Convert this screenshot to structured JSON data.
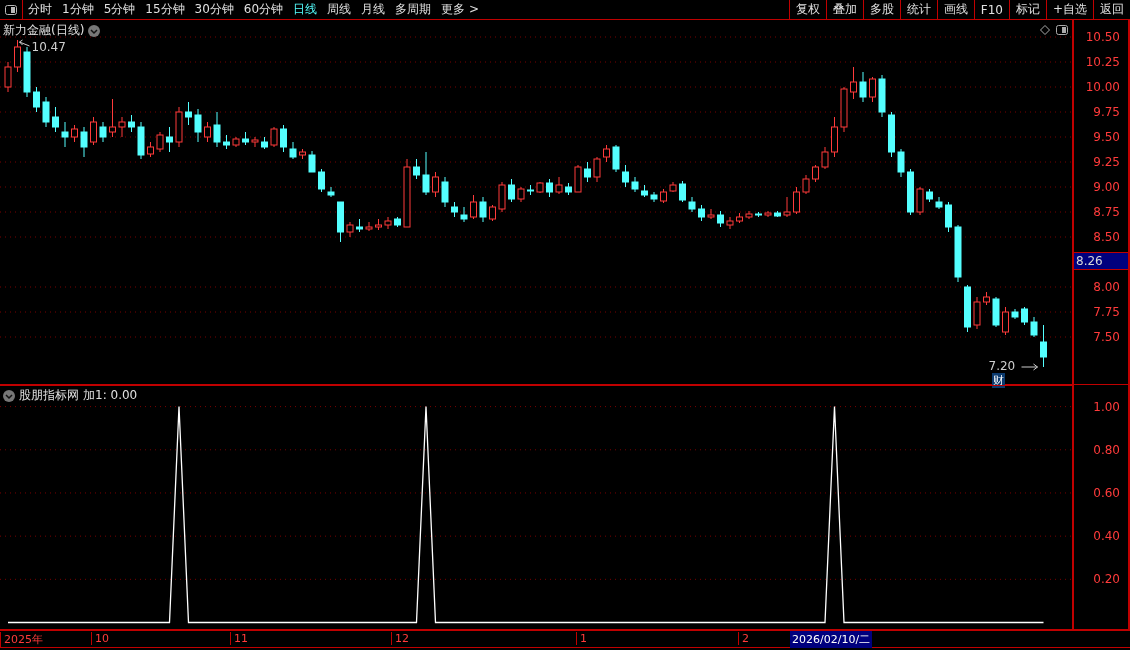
{
  "toolbar": {
    "periods": [
      {
        "label": "分时",
        "selected": false
      },
      {
        "label": "1分钟",
        "selected": false
      },
      {
        "label": "5分钟",
        "selected": false
      },
      {
        "label": "15分钟",
        "selected": false
      },
      {
        "label": "30分钟",
        "selected": false
      },
      {
        "label": "60分钟",
        "selected": false
      },
      {
        "label": "日线",
        "selected": true
      },
      {
        "label": "周线",
        "selected": false
      },
      {
        "label": "月线",
        "selected": false
      },
      {
        "label": "多周期",
        "selected": false
      },
      {
        "label": "更多 >",
        "selected": false
      }
    ],
    "actions": [
      "复权",
      "叠加",
      "多股",
      "统计",
      "画线",
      "F10",
      "标记",
      "+自选",
      "返回"
    ]
  },
  "main_chart": {
    "title": "新力金融(日线)",
    "high_marker": "10.47",
    "low_marker": "7.20",
    "finance_badge": "财",
    "current_price": "8.26",
    "chart_data": {
      "type": "candlestick",
      "ylim": [
        7.03,
        10.67
      ],
      "grid": true,
      "yticks": [
        {
          "value": 10.5,
          "label": "10.50"
        },
        {
          "value": 10.25,
          "label": "10.25"
        },
        {
          "value": 10,
          "label": "10.00"
        },
        {
          "value": 9.75,
          "label": "9.75"
        },
        {
          "value": 9.5,
          "label": "9.50"
        },
        {
          "value": 9.25,
          "label": "9.25"
        },
        {
          "value": 9,
          "label": "9.00"
        },
        {
          "value": 8.75,
          "label": "8.75"
        },
        {
          "value": 8.5,
          "label": "8.50"
        },
        {
          "value": 8,
          "label": "8.00"
        },
        {
          "value": 7.75,
          "label": "7.75"
        },
        {
          "value": 7.5,
          "label": "7.50"
        }
      ],
      "ohlc": [
        [
          10.0,
          10.25,
          9.95,
          10.2
        ],
        [
          10.2,
          10.47,
          10.15,
          10.4
        ],
        [
          10.35,
          10.4,
          9.9,
          9.95
        ],
        [
          9.95,
          10.0,
          9.75,
          9.8
        ],
        [
          9.85,
          9.9,
          9.6,
          9.65
        ],
        [
          9.7,
          9.8,
          9.55,
          9.6
        ],
        [
          9.55,
          9.65,
          9.4,
          9.5
        ],
        [
          9.5,
          9.62,
          9.45,
          9.58
        ],
        [
          9.55,
          9.6,
          9.3,
          9.4
        ],
        [
          9.45,
          9.7,
          9.42,
          9.65
        ],
        [
          9.6,
          9.65,
          9.45,
          9.5
        ],
        [
          9.55,
          9.88,
          9.5,
          9.6
        ],
        [
          9.6,
          9.7,
          9.5,
          9.65
        ],
        [
          9.65,
          9.72,
          9.55,
          9.6
        ],
        [
          9.6,
          9.65,
          9.28,
          9.32
        ],
        [
          9.33,
          9.45,
          9.3,
          9.4
        ],
        [
          9.38,
          9.55,
          9.35,
          9.52
        ],
        [
          9.5,
          9.6,
          9.35,
          9.45
        ],
        [
          9.45,
          9.8,
          9.4,
          9.75
        ],
        [
          9.75,
          9.85,
          9.62,
          9.7
        ],
        [
          9.72,
          9.78,
          9.45,
          9.55
        ],
        [
          9.5,
          9.65,
          9.45,
          9.6
        ],
        [
          9.62,
          9.75,
          9.4,
          9.45
        ],
        [
          9.45,
          9.52,
          9.38,
          9.42
        ],
        [
          9.42,
          9.5,
          9.4,
          9.48
        ],
        [
          9.48,
          9.55,
          9.42,
          9.45
        ],
        [
          9.45,
          9.5,
          9.4,
          9.47
        ],
        [
          9.45,
          9.5,
          9.38,
          9.4
        ],
        [
          9.42,
          9.6,
          9.4,
          9.58
        ],
        [
          9.58,
          9.62,
          9.35,
          9.4
        ],
        [
          9.38,
          9.45,
          9.28,
          9.3
        ],
        [
          9.32,
          9.38,
          9.28,
          9.35
        ],
        [
          9.32,
          9.36,
          9.15,
          9.15
        ],
        [
          9.15,
          9.18,
          8.95,
          8.98
        ],
        [
          8.95,
          9.0,
          8.9,
          8.92
        ],
        [
          8.85,
          8.85,
          8.45,
          8.55
        ],
        [
          8.55,
          8.65,
          8.5,
          8.62
        ],
        [
          8.6,
          8.68,
          8.55,
          8.58
        ],
        [
          8.58,
          8.65,
          8.56,
          8.6
        ],
        [
          8.6,
          8.68,
          8.57,
          8.62
        ],
        [
          8.62,
          8.7,
          8.58,
          8.66
        ],
        [
          8.68,
          8.7,
          8.6,
          8.62
        ],
        [
          8.6,
          9.28,
          8.6,
          9.2
        ],
        [
          9.2,
          9.28,
          9.08,
          9.12
        ],
        [
          9.12,
          9.35,
          8.92,
          8.95
        ],
        [
          8.95,
          9.15,
          8.9,
          9.1
        ],
        [
          9.05,
          9.1,
          8.8,
          8.85
        ],
        [
          8.8,
          8.85,
          8.7,
          8.75
        ],
        [
          8.72,
          8.8,
          8.65,
          8.68
        ],
        [
          8.7,
          8.92,
          8.68,
          8.85
        ],
        [
          8.85,
          8.9,
          8.65,
          8.7
        ],
        [
          8.68,
          8.82,
          8.66,
          8.8
        ],
        [
          8.78,
          9.05,
          8.75,
          9.02
        ],
        [
          9.02,
          9.08,
          8.85,
          8.88
        ],
        [
          8.88,
          9.0,
          8.85,
          8.98
        ],
        [
          8.97,
          9.02,
          8.92,
          8.96
        ],
        [
          8.95,
          9.05,
          8.94,
          9.04
        ],
        [
          9.04,
          9.08,
          8.9,
          8.95
        ],
        [
          8.95,
          9.1,
          8.93,
          9.02
        ],
        [
          9.0,
          9.04,
          8.92,
          8.95
        ],
        [
          8.95,
          9.22,
          8.95,
          9.2
        ],
        [
          9.18,
          9.25,
          9.05,
          9.1
        ],
        [
          9.1,
          9.3,
          9.05,
          9.28
        ],
        [
          9.3,
          9.42,
          9.25,
          9.38
        ],
        [
          9.4,
          9.42,
          9.15,
          9.18
        ],
        [
          9.15,
          9.22,
          9.0,
          9.05
        ],
        [
          9.05,
          9.1,
          8.95,
          8.98
        ],
        [
          8.96,
          9.02,
          8.9,
          8.92
        ],
        [
          8.92,
          8.95,
          8.85,
          8.88
        ],
        [
          8.86,
          8.98,
          8.84,
          8.95
        ],
        [
          8.96,
          9.05,
          8.95,
          9.02
        ],
        [
          9.03,
          9.06,
          8.85,
          8.87
        ],
        [
          8.85,
          8.9,
          8.75,
          8.78
        ],
        [
          8.78,
          8.82,
          8.66,
          8.7
        ],
        [
          8.7,
          8.78,
          8.68,
          8.72
        ],
        [
          8.72,
          8.76,
          8.6,
          8.64
        ],
        [
          8.62,
          8.7,
          8.58,
          8.66
        ],
        [
          8.66,
          8.74,
          8.64,
          8.7
        ],
        [
          8.7,
          8.76,
          8.68,
          8.73
        ],
        [
          8.73,
          8.75,
          8.7,
          8.72
        ],
        [
          8.72,
          8.76,
          8.7,
          8.74
        ],
        [
          8.74,
          8.76,
          8.7,
          8.71
        ],
        [
          8.72,
          8.9,
          8.7,
          8.75
        ],
        [
          8.75,
          9.0,
          8.73,
          8.95
        ],
        [
          8.95,
          9.12,
          8.93,
          9.08
        ],
        [
          9.08,
          9.22,
          9.05,
          9.2
        ],
        [
          9.2,
          9.4,
          9.18,
          9.35
        ],
        [
          9.35,
          9.7,
          9.3,
          9.6
        ],
        [
          9.6,
          10.0,
          9.55,
          9.98
        ],
        [
          9.95,
          10.2,
          9.88,
          10.05
        ],
        [
          10.05,
          10.15,
          9.85,
          9.9
        ],
        [
          9.9,
          10.1,
          9.85,
          10.08
        ],
        [
          10.08,
          10.12,
          9.7,
          9.75
        ],
        [
          9.72,
          9.75,
          9.3,
          9.35
        ],
        [
          9.35,
          9.38,
          9.1,
          9.15
        ],
        [
          9.15,
          9.18,
          8.72,
          8.75
        ],
        [
          8.75,
          9.0,
          8.72,
          8.98
        ],
        [
          8.95,
          8.98,
          8.85,
          8.88
        ],
        [
          8.85,
          8.9,
          8.78,
          8.8
        ],
        [
          8.82,
          8.85,
          8.55,
          8.6
        ],
        [
          8.6,
          8.62,
          8.05,
          8.1
        ],
        [
          8.0,
          8.02,
          7.55,
          7.6
        ],
        [
          7.62,
          7.9,
          7.58,
          7.85
        ],
        [
          7.85,
          7.95,
          7.82,
          7.9
        ],
        [
          7.88,
          7.9,
          7.6,
          7.62
        ],
        [
          7.55,
          7.8,
          7.52,
          7.75
        ],
        [
          7.75,
          7.78,
          7.68,
          7.7
        ],
        [
          7.78,
          7.8,
          7.62,
          7.65
        ],
        [
          7.65,
          7.7,
          7.5,
          7.52
        ],
        [
          7.45,
          7.62,
          7.2,
          7.3
        ]
      ]
    }
  },
  "indicator": {
    "title": "股朋指标网",
    "readout": "加1: 0.00",
    "chart_data": {
      "type": "line",
      "ylim": [
        -0.03,
        1.1
      ],
      "grid": true,
      "yticks": [
        {
          "value": 0.2,
          "label": "0.20"
        },
        {
          "value": 0.4,
          "label": "0.40"
        },
        {
          "value": 0.6,
          "label": "0.60"
        },
        {
          "value": 0.8,
          "label": "0.80"
        },
        {
          "value": 1,
          "label": "1.00"
        }
      ],
      "series": [
        {
          "color": "#ffffff",
          "values": [
            0,
            0,
            0,
            0,
            0,
            0,
            0,
            0,
            0,
            0,
            0,
            0,
            0,
            0,
            0,
            0,
            0,
            0,
            1,
            0,
            0,
            0,
            0,
            0,
            0,
            0,
            0,
            0,
            0,
            0,
            0,
            0,
            0,
            0,
            0,
            0,
            0,
            0,
            0,
            0,
            0,
            0,
            0,
            0,
            1,
            0,
            0,
            0,
            0,
            0,
            0,
            0,
            0,
            0,
            0,
            0,
            0,
            0,
            0,
            0,
            0,
            0,
            0,
            0,
            0,
            0,
            0,
            0,
            0,
            0,
            0,
            0,
            0,
            0,
            0,
            0,
            0,
            0,
            0,
            0,
            0,
            0,
            0,
            0,
            0,
            0,
            0,
            1,
            0,
            0,
            0,
            0,
            0,
            0,
            0,
            0,
            0,
            0,
            0,
            0,
            0,
            0,
            0,
            0,
            0,
            0,
            0,
            0,
            0,
            0
          ]
        }
      ]
    }
  },
  "date_axis": {
    "labels": [
      "2025年",
      "10",
      "11",
      "12",
      "1",
      "2"
    ],
    "cursor_date": "2026/02/10/二"
  }
}
